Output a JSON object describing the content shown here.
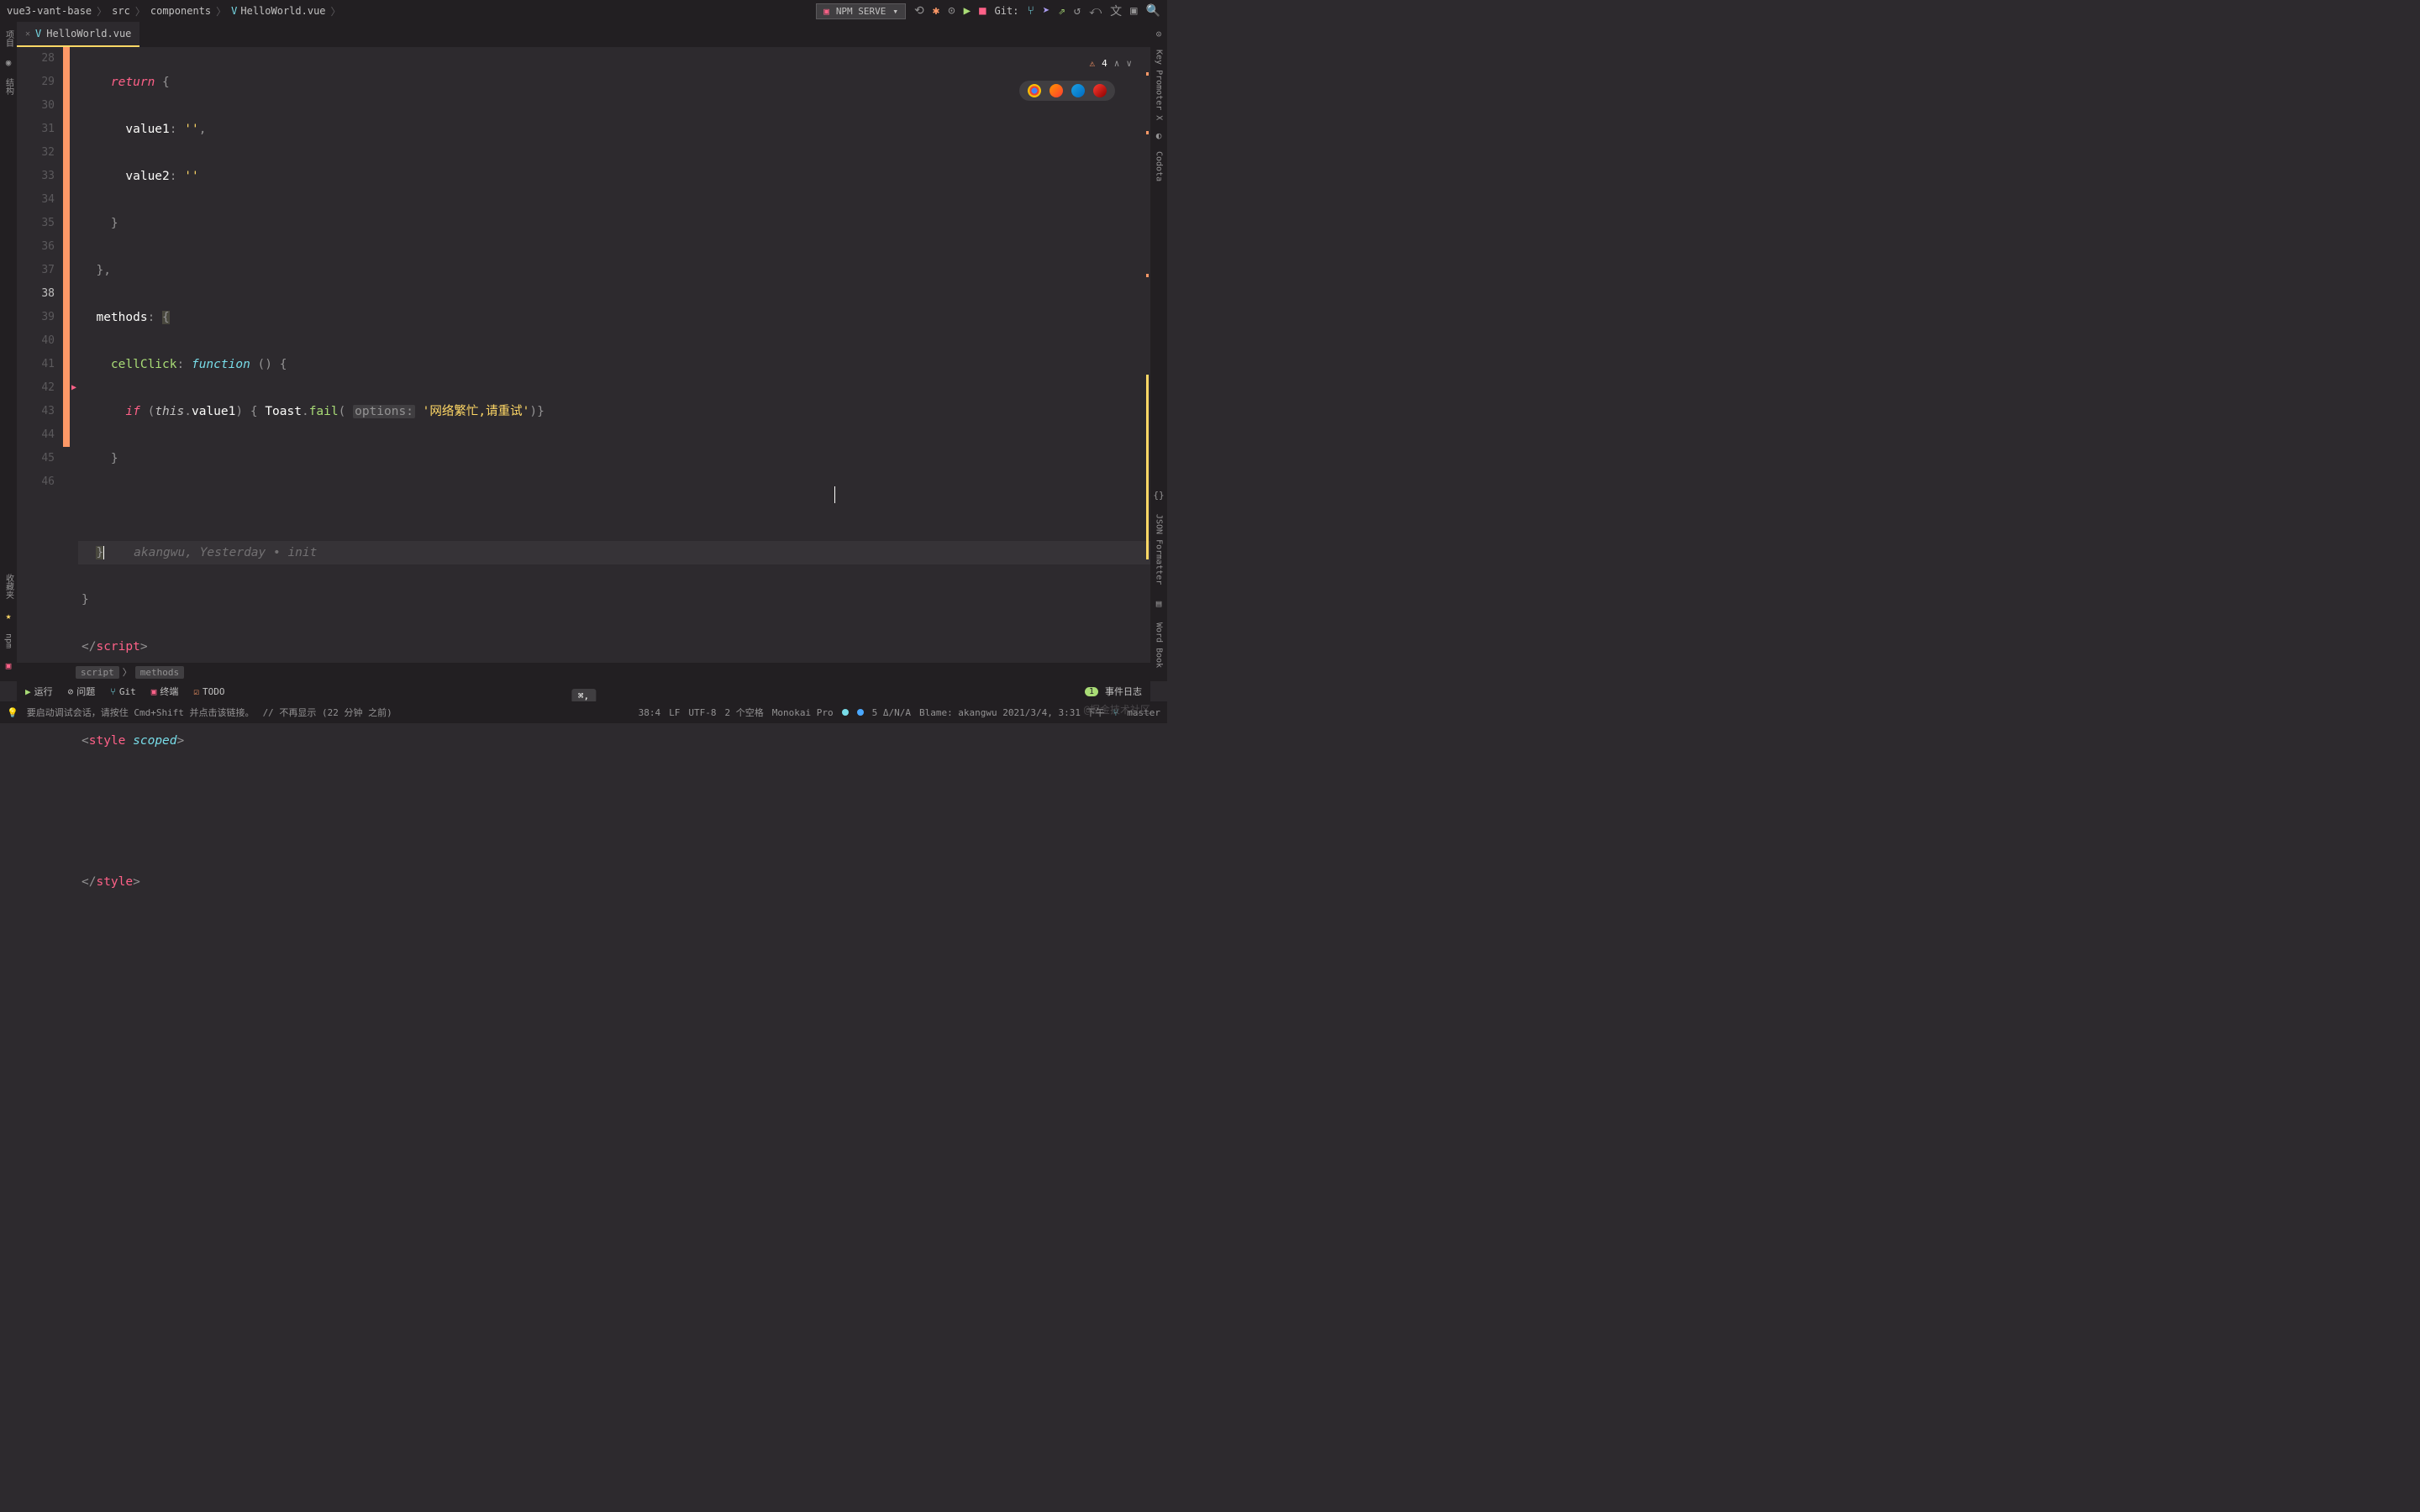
{
  "breadcrumb": {
    "project": "vue3-vant-base",
    "src": "src",
    "components": "components",
    "file": "HelloWorld.vue"
  },
  "run_config": {
    "label": "NPM SERVE"
  },
  "git_label": "Git:",
  "tab": {
    "filename": "HelloWorld.vue"
  },
  "left_sidebar": {
    "project": "项目",
    "structure": "结构",
    "favorites": "收藏夹",
    "npm": "npm"
  },
  "right_sidebar": {
    "key_promoter": "Key Promoter X",
    "codota": "Codota",
    "json_formatter": "JSON Formatter",
    "word_book": "Word Book"
  },
  "editor_warnings": {
    "count": "4"
  },
  "code_lines": {
    "28": {
      "num": "28"
    },
    "29": {
      "num": "29"
    },
    "30": {
      "num": "30"
    },
    "31": {
      "num": "31"
    },
    "32": {
      "num": "32"
    },
    "33": {
      "num": "33"
    },
    "34": {
      "num": "34"
    },
    "35": {
      "num": "35"
    },
    "36": {
      "num": "36"
    },
    "37": {
      "num": "37"
    },
    "38": {
      "num": "38"
    },
    "39": {
      "num": "39"
    },
    "40": {
      "num": "40"
    },
    "41": {
      "num": "41"
    },
    "42": {
      "num": "42"
    },
    "43": {
      "num": "43"
    },
    "44": {
      "num": "44"
    },
    "45": {
      "num": "45"
    },
    "46": {
      "num": "46"
    }
  },
  "tokens": {
    "return": "return",
    "brace_open": "{",
    "brace_close": "}",
    "value1": "value1",
    "value2": "value2",
    "colon": ":",
    "empty_str": "''",
    "comma": ",",
    "methods": "methods",
    "cellClick": "cellClick",
    "function": "function",
    "parens": "()",
    "if": "if",
    "paren_open": "(",
    "paren_close": ")",
    "this": "this",
    "dot": ".",
    "Toast": "Toast",
    "fail": "fail",
    "options_hint": "options:",
    "fail_str": "'网络繁忙,请重试'",
    "blame": "akangwu, Yesterday • init",
    "script_close_open": "</",
    "script_tag": "script",
    "gt": ">",
    "lt": "<",
    "style_tag": "style",
    "scoped": "scoped",
    "slash": "/"
  },
  "editor_breadcrumb": {
    "script": "script",
    "methods": "methods"
  },
  "bottom_toolbar": {
    "run": "运行",
    "problems": "问题",
    "git": "Git",
    "terminal": "终端",
    "todo": "TODO",
    "event_log": "事件日志",
    "event_count": "1"
  },
  "kbd_hint": "⌘,",
  "status": {
    "debug_hint": "要启动调试会话，请按住 Cmd+Shift 并点击该链接。",
    "dismiss": "// 不再显示 (22 分钟 之前)",
    "cursor": "38:4",
    "line_ending": "LF",
    "encoding": "UTF-8",
    "indent": "2 个空格",
    "theme": "Monokai Pro",
    "delta": "5 Δ/N/A",
    "blame": "Blame: akangwu 2021/3/4, 3:31 下午",
    "branch": "master"
  },
  "watermark": "@掘金技术社区"
}
